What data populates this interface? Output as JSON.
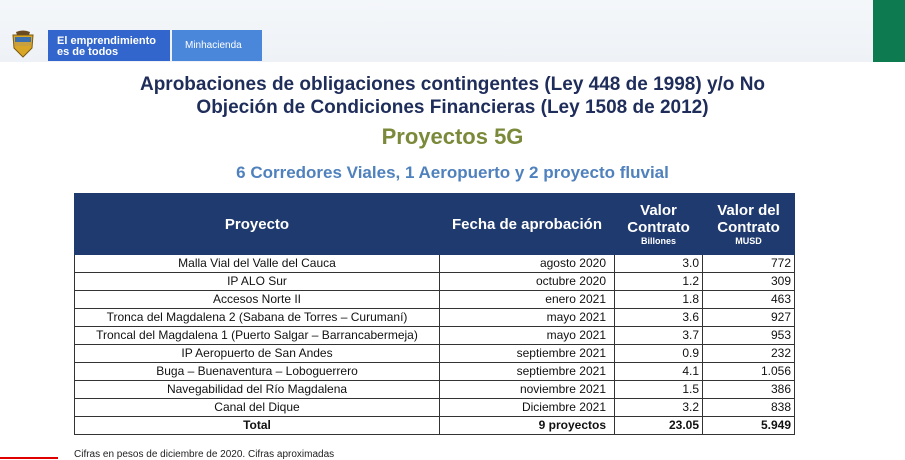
{
  "header": {
    "slogan_line1": "El emprendimiento",
    "slogan_line2": "es de todos",
    "ministry": "Minhacienda",
    "colors": {
      "slogan_bg": "#3366cc",
      "ministry_bg": "#4a87db",
      "accent_green": "#0d7a4f"
    }
  },
  "title": {
    "line1": "Aprobaciones de obligaciones contingentes (Ley 448 de 1998) y/o No",
    "line2": "Objeción de Condiciones Financieras (Ley 1508 de 2012)"
  },
  "section_title": "Proyectos 5G",
  "subtitle": "6 Corredores Viales, 1 Aeropuerto y 2 proyecto fluvial",
  "table": {
    "headers": {
      "proyecto": "Proyecto",
      "fecha": "Fecha de aprobación",
      "valor_contrato_line1": "Valor",
      "valor_contrato_line2": "Contrato",
      "valor_contrato_unit": "Billones",
      "valor_usd_line1": "Valor del",
      "valor_usd_line2": "Contrato",
      "valor_usd_unit": "MUSD"
    },
    "rows": [
      {
        "proyecto": "Malla Vial del Valle del Cauca",
        "fecha": "agosto 2020",
        "valor": "3.0",
        "usd": "772"
      },
      {
        "proyecto": "IP ALO Sur",
        "fecha": "octubre  2020",
        "valor": "1.2",
        "usd": "309"
      },
      {
        "proyecto": "Accesos Norte II",
        "fecha": "enero  2021",
        "valor": "1.8",
        "usd": "463"
      },
      {
        "proyecto": "Tronca del Magdalena 2 (Sabana de Torres – Curumaní)",
        "fecha": "mayo 2021",
        "valor": "3.6",
        "usd": "927"
      },
      {
        "proyecto": "Troncal del Magdalena 1 (Puerto Salgar – Barrancabermeja)",
        "fecha": "mayo  2021",
        "valor": "3.7",
        "usd": "953"
      },
      {
        "proyecto": "IP Aeropuerto de San Andes",
        "fecha": "septiembre  2021",
        "valor": "0.9",
        "usd": "232"
      },
      {
        "proyecto": "Buga – Buenaventura – Loboguerrero",
        "fecha": "septiembre  2021",
        "valor": "4.1",
        "usd": "1.056"
      },
      {
        "proyecto": "Navegabilidad del Río Magdalena",
        "fecha": "noviembre  2021",
        "valor": "1.5",
        "usd": "386"
      },
      {
        "proyecto": "Canal del Dique",
        "fecha": "Diciembre  2021",
        "valor": "3.2",
        "usd": "838"
      }
    ],
    "total": {
      "label": "Total",
      "fecha": "9 proyectos",
      "valor": "23.05",
      "usd": "5.949"
    }
  },
  "note": "Cifras en pesos de diciembre de 2020. Cifras aproximadas"
}
